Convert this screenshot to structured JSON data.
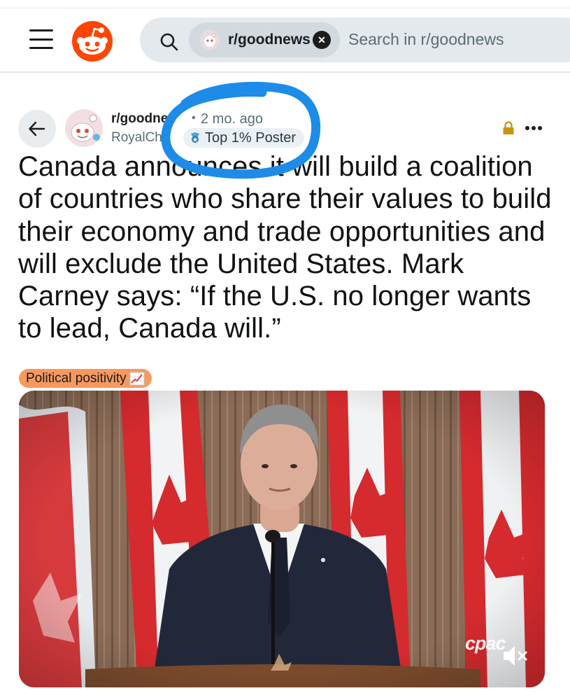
{
  "header": {
    "search": {
      "scope_chip_label": "r/goodnews",
      "placeholder": "Search in r/goodnews"
    }
  },
  "post": {
    "subreddit": "r/goodnews",
    "author": "RoyalCh",
    "age": "2 mo. ago",
    "age_separator": "•",
    "badge": "Top 1% Poster",
    "title": "Canada announces it will build a coalition of countries who share their values to build their economy and trade opportunities and will exclude the United States. Mark Carney says: “If the U.S. no longer wants to lead, Canada will.”",
    "flair": {
      "label": "Political positivity",
      "icon": "chart-increasing-icon"
    },
    "media": {
      "watermark": "cpac",
      "muted": true
    }
  },
  "icons": [
    "menu-icon",
    "reddit-logo-icon",
    "search-icon",
    "close-icon",
    "back-arrow-icon",
    "lock-icon",
    "more-icon",
    "mute-icon"
  ],
  "colors": {
    "brand": "#ff4500",
    "flair_background": "#f7995e",
    "annotation": "#1d8ce8",
    "lock": "#c9920f"
  }
}
